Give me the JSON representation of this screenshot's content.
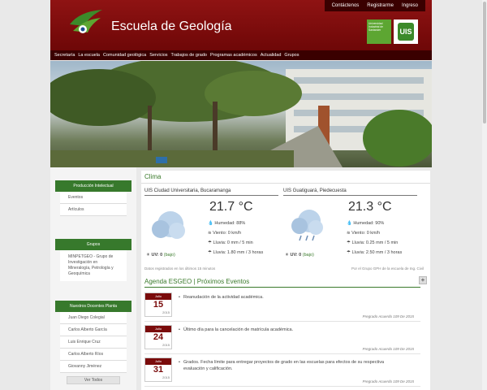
{
  "header": {
    "site_title": "Escuela de Geología",
    "top_links": [
      "Contáctenos",
      "Registrarme",
      "Ingreso"
    ],
    "uis_text": "Universidad Industrial de Santander",
    "uis_logo": "UIS"
  },
  "nav": [
    "Secretaría",
    "La escuela",
    "Comunidad geológica",
    "Servicios",
    "Trabajos de grado",
    "Programas académicos",
    "Actualidad",
    "Grupos"
  ],
  "sidebar": {
    "produccion": {
      "title": "Producción Intelectual",
      "items": [
        "Eventos",
        "Artículos"
      ]
    },
    "grupos": {
      "title": "Grupos",
      "note": "MINPETGEO - Grupo de Investigación en Mineralogía, Petrología y Geoquímica"
    },
    "docentes": {
      "title": "Nuestros Docentes Planta",
      "items": [
        "Juan Diego Colegial",
        "Carlos Alberto García",
        "Luis Enrique Cruz",
        "Carlos Alberto Ríos",
        "Giovanny Jiménez"
      ],
      "more": "Ver Todos"
    }
  },
  "clima": {
    "title": "Clima",
    "stations": [
      {
        "location": "UIS Ciudad Universitaria, Bucaramanga",
        "temp": "21.7 °C",
        "humidity": "Humedad: 88%",
        "wind": "Viento: 0 km/h",
        "rain": "Lluvia: 0 mm / 5 min",
        "rain3h": "Lluvia: 1.80 mm / 3 horas",
        "uv_label": "UV: 0",
        "uv_level": "(bajo)"
      },
      {
        "location": "UIS Guatiguará, Piedecuesta",
        "temp": "21.3 °C",
        "humidity": "Humedad: 90%",
        "wind": "Viento: 0 km/h",
        "rain": "Lluvia: 0.25 mm / 5 min",
        "rain3h": "Lluvia: 2.50 mm / 3 horas",
        "uv_label": "UV: 0",
        "uv_level": "(bajo)"
      }
    ],
    "footnote_left": "Datos registrados en los últimos 15 minutos",
    "footnote_right": "Por el Grupo GPH de la escuela de Ing. Civil"
  },
  "agenda": {
    "title": "Agenda ESGEO | Próximos Eventos",
    "plus": "+",
    "events": [
      {
        "month": "Julio",
        "day": "15",
        "year": "2015",
        "text": "Reanudación de la actividad académica.",
        "meta": "Pregrado Acuerdo 109 De 2015"
      },
      {
        "month": "Julio",
        "day": "24",
        "year": "2015",
        "text": "Último día para la cancelación de matrícula académica.",
        "meta": "Pregrado Acuerdo 109 De 2015"
      },
      {
        "month": "Julio",
        "day": "31",
        "year": "2015",
        "text": "Grados. Fecha límite para entregar proyectos de grado en las escuelas para efectos de su respectiva evaluación y calificación.",
        "meta": "Pregrado Acuerdo 109 De 2015"
      }
    ]
  }
}
